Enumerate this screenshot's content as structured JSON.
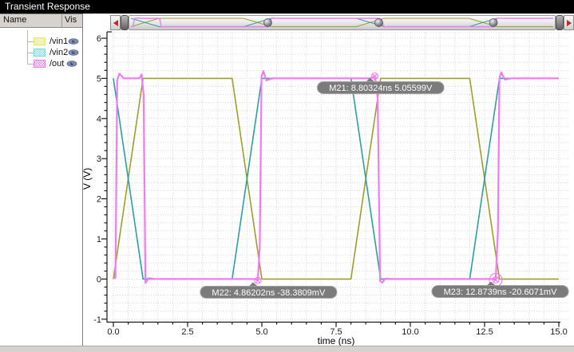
{
  "window": {
    "title": "Transient Response"
  },
  "panel": {
    "columns": {
      "name": "Name",
      "vis": "Vis"
    },
    "signals": [
      {
        "name": "/vin1",
        "color": "#9e9e2e",
        "swatch": "#e6e670",
        "visible": true
      },
      {
        "name": "/vin2",
        "color": "#2e9e9e",
        "swatch": "#7adada",
        "visible": true
      },
      {
        "name": "/out",
        "color": "#f07cf0",
        "swatch": "#ea80ea",
        "visible": true
      }
    ]
  },
  "colors": {
    "grid": "#d6d6d6",
    "axis": "#1a1a1a",
    "marker_pill": "#7b7b7b",
    "marker_pill_border": "#a0a0a0",
    "marker_text": "#ffffff",
    "marker_ring": "#f07cf0",
    "eye": "#7d8fae"
  },
  "chart_data": {
    "type": "line",
    "title": "Transient Response",
    "xlabel": "time (ns)",
    "ylabel": "V (V)",
    "xlim": [
      0,
      15
    ],
    "ylim": [
      -1,
      6
    ],
    "x_major_step": 2.5,
    "x_minor_step": 0.5,
    "y_major_step": 1,
    "y_minor_step": 0.2,
    "x_tick_labels": [
      "0.0",
      "2.5",
      "5.0",
      "7.5",
      "10.0",
      "12.5",
      "15.0"
    ],
    "y_tick_labels": [
      "-1",
      "0",
      "1",
      "2",
      "3",
      "4",
      "5",
      "6"
    ],
    "grid": true,
    "legend_position": "left-panel",
    "series": [
      {
        "name": "/vin1",
        "color": "#9e9e2e",
        "width": 1.6,
        "points": [
          [
            0,
            0
          ],
          [
            1,
            5
          ],
          [
            4,
            5
          ],
          [
            5,
            0
          ],
          [
            8,
            0
          ],
          [
            9,
            5
          ],
          [
            12,
            5
          ],
          [
            13,
            0
          ],
          [
            15,
            0
          ]
        ]
      },
      {
        "name": "/vin2",
        "color": "#2e9e9e",
        "width": 1.6,
        "points": [
          [
            0,
            5
          ],
          [
            1,
            0
          ],
          [
            4,
            0
          ],
          [
            5,
            5
          ],
          [
            8,
            5
          ],
          [
            9,
            0
          ],
          [
            12,
            0
          ],
          [
            13,
            5
          ],
          [
            15,
            5
          ]
        ]
      },
      {
        "name": "/out",
        "color": "#f07cf0",
        "width": 2.2,
        "points": [
          [
            0,
            0.03
          ],
          [
            0.07,
            0.03
          ],
          [
            0.13,
            4.95
          ],
          [
            0.2,
            5.12
          ],
          [
            0.35,
            5.0
          ],
          [
            0.88,
            5.0
          ],
          [
            0.95,
            5.1
          ],
          [
            1.02,
            4.6
          ],
          [
            1.08,
            -0.1
          ],
          [
            1.18,
            0.02
          ],
          [
            1.4,
            0
          ],
          [
            4.7,
            0
          ],
          [
            4.8,
            -0.005
          ],
          [
            4.86202,
            -0.0383809
          ],
          [
            4.93,
            0.8
          ],
          [
            4.99,
            5.05
          ],
          [
            5.05,
            5.18
          ],
          [
            5.15,
            4.95
          ],
          [
            5.35,
            5.0
          ],
          [
            8.65,
            5.0
          ],
          [
            8.80324,
            5.05599
          ],
          [
            8.9,
            4.5
          ],
          [
            8.98,
            -0.05
          ],
          [
            9.06,
            -0.09
          ],
          [
            9.15,
            0.01
          ],
          [
            9.4,
            0
          ],
          [
            12.75,
            0
          ],
          [
            12.8739,
            -0.0206071
          ],
          [
            12.95,
            1.2
          ],
          [
            13.0,
            5.0
          ],
          [
            13.06,
            5.15
          ],
          [
            13.18,
            4.97
          ],
          [
            13.4,
            5
          ],
          [
            15,
            5
          ]
        ]
      }
    ],
    "markers": [
      {
        "name": "M21",
        "label": "M21: 8.80324ns 5.05599V",
        "t": 8.80324,
        "v": 5.05599,
        "rings": 1
      },
      {
        "name": "M22",
        "label": "M22: 4.86202ns -38.3809mV",
        "t": 4.86202,
        "v": -0.0383809,
        "rings": 1
      },
      {
        "name": "M23",
        "label": "M23: 12.8739ns -20.6071mV",
        "t": 12.8739,
        "v": -0.0206071,
        "rings": 2
      }
    ]
  }
}
